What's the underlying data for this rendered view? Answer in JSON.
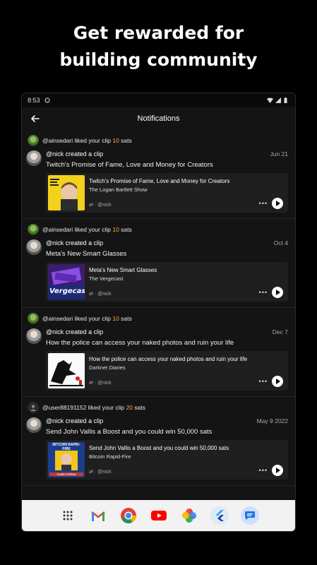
{
  "headline": {
    "line1": "Get rewarded for",
    "line2": "building community"
  },
  "statusbar": {
    "time": "8:53"
  },
  "appbar": {
    "title": "Notifications"
  },
  "icons": {
    "back": "arrow-back-icon",
    "more": "more-horiz-icon",
    "play": "play-icon",
    "repost": "repost-icon"
  },
  "colors": {
    "sats": "#f6a93b",
    "background": "#141414",
    "card": "#1f1f1f"
  },
  "notifications": [
    {
      "like_user": "@ainsedari",
      "like_text": " liked your clip ",
      "sats": "10",
      "sats_label": " sats",
      "poster": "@nick",
      "action": " created a clip",
      "date": "Jun 21",
      "post_text": "Twitch's Promise of Fame, Love and Money for Creators",
      "card_title": "Twitch's Promise of Fame, Love and Money for Creators",
      "card_show": "The Logan Bartlett Show",
      "card_meta": "@nick"
    },
    {
      "like_user": "@ainsedari",
      "like_text": " liked your clip ",
      "sats": "10",
      "sats_label": " sats",
      "poster": "@nick",
      "action": " created a clip",
      "date": "Oct 4",
      "post_text": "Meta's New Smart Glasses",
      "card_title": "Meta's New Smart Glasses",
      "card_show": "The Vergecast",
      "card_meta": "@nick"
    },
    {
      "like_user": "@ainsedari",
      "like_text": " liked your clip ",
      "sats": "10",
      "sats_label": " sats",
      "poster": "@nick",
      "action": " created a clip",
      "date": "Dec 7",
      "post_text": "How the police can access your naked photos and ruin your life",
      "card_title": "How the police can access your naked photos and ruin your life",
      "card_show": "Darknet Diaries",
      "card_meta": "@nick"
    },
    {
      "like_user": "@user88191152",
      "like_text": " liked your clip ",
      "sats": "20",
      "sats_label": " sats",
      "poster": "@nick",
      "action": " created a clip",
      "date": "May 9 2022",
      "post_text": "Send John Vallis a Boost and you could win 50,000 sats",
      "card_title": "Send John Vallis a Boost and you could win 50,000 sats",
      "card_show": "Bitcoin Rapid-Fire",
      "card_meta": "@nick"
    }
  ],
  "thumb_text": {
    "vergecast": "Vergecast",
    "bitcoin": "BITCOIN RAPID-FIRE",
    "bitcoin_name": "Austin Kelsey"
  },
  "dock": [
    "app-grid-icon",
    "gmail-icon",
    "chrome-icon",
    "youtube-icon",
    "photos-icon",
    "flutter-icon",
    "messages-icon"
  ]
}
